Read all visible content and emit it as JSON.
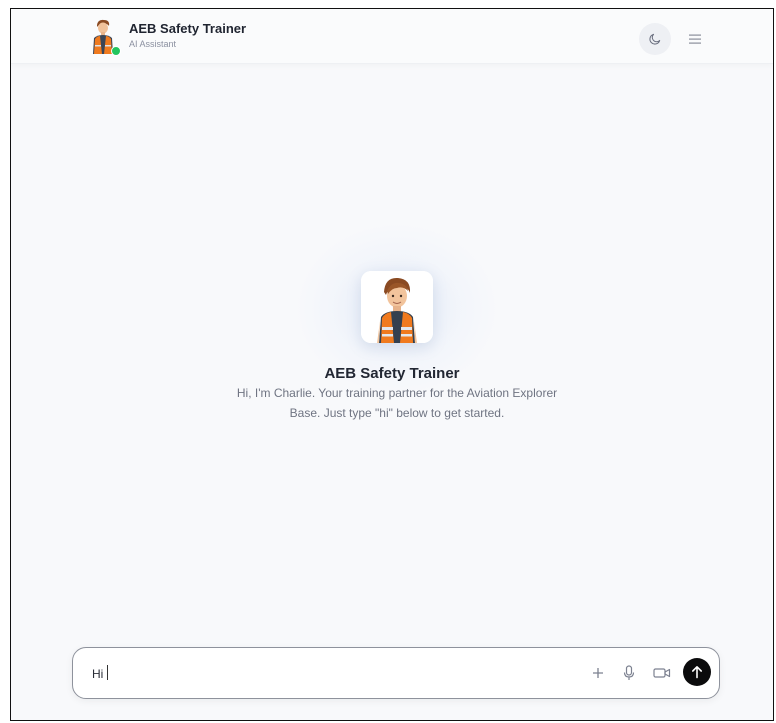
{
  "header": {
    "title": "AEB Safety Trainer",
    "subtitle": "AI Assistant",
    "status": "online",
    "status_color": "#22c55e"
  },
  "header_actions": {
    "theme_icon": "moon-icon",
    "menu_icon": "hamburger-menu-icon"
  },
  "welcome": {
    "title": "AEB Safety Trainer",
    "description": "Hi, I'm Charlie. Your training partner for the Aviation Explorer Base. Just type \"hi\" below to get started.",
    "avatar_icon": "charlie-avatar-icon"
  },
  "composer": {
    "value": "Hi",
    "actions": [
      "plus-icon",
      "microphone-icon",
      "video-camera-icon",
      "send-arrow-icon"
    ],
    "send_color": "#0b0b0c"
  },
  "colors": {
    "background": "#f8f9fb",
    "vest": "#f07a1e",
    "text_primary": "#222733",
    "text_secondary": "#6f7482"
  }
}
